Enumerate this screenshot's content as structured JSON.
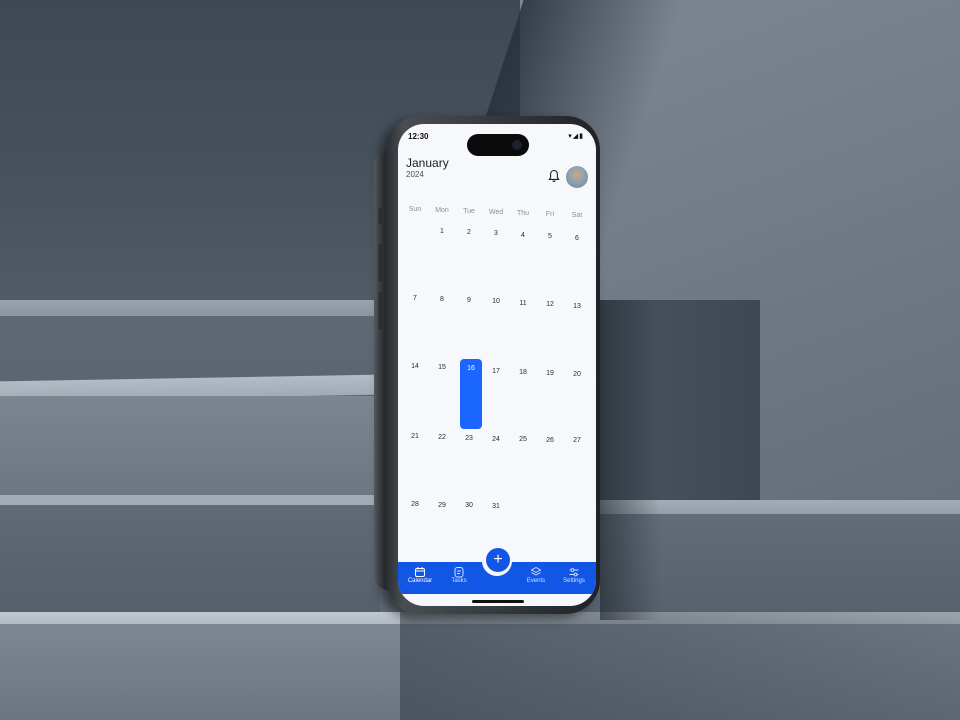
{
  "status": {
    "time": "12:30"
  },
  "header": {
    "month": "January",
    "year": "2024"
  },
  "weekdays": [
    "Sun",
    "Mon",
    "Tue",
    "Wed",
    "Thu",
    "Fri",
    "Sat"
  ],
  "calendar": {
    "selected_day": "16",
    "weeks": [
      [
        "",
        "1",
        "2",
        "3",
        "4",
        "5",
        "6"
      ],
      [
        "7",
        "8",
        "9",
        "10",
        "11",
        "12",
        "13"
      ],
      [
        "14",
        "15",
        "16",
        "17",
        "18",
        "19",
        "20"
      ],
      [
        "21",
        "22",
        "23",
        "24",
        "25",
        "26",
        "27"
      ],
      [
        "28",
        "29",
        "30",
        "31",
        "",
        "",
        ""
      ]
    ]
  },
  "tabbar": {
    "calendar": "Calendar",
    "tasks": "Tasks",
    "events": "Events",
    "settings": "Settings",
    "fab_symbol": "+"
  },
  "colors": {
    "accent": "#1256e5",
    "selected": "#1a66ff",
    "screen_bg": "#f7f8fc"
  }
}
